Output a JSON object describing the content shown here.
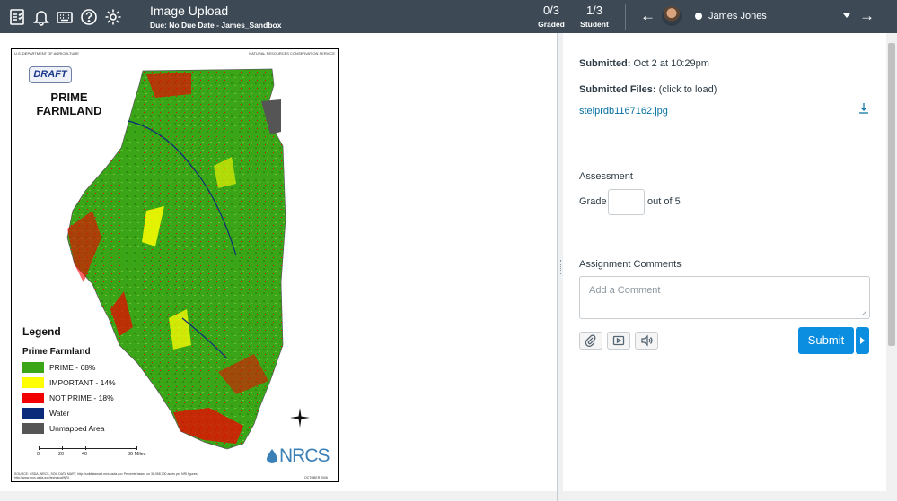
{
  "header": {
    "icons": [
      "assignment-list-icon",
      "bell-icon",
      "keyboard-icon",
      "help-icon",
      "gear-icon"
    ],
    "title": "Image Upload",
    "due": "Due: No Due Date - James_Sandbox",
    "graded_num": "0/3",
    "graded_label": "Graded",
    "student_num": "1/3",
    "student_label": "Student",
    "prev_arrow": "←",
    "next_arrow": "→",
    "student_name": "James Jones"
  },
  "map": {
    "header_left": "U.S. DEPARTMENT OF AGRICULTURE",
    "header_right": "NATURAL RESOURCES CONSERVATION SERVICE",
    "draft": "DRAFT",
    "title": "PRIME FARMLAND",
    "legend_title": "Legend",
    "legend_subtitle": "Prime Farmland",
    "legend": [
      {
        "label": "PRIME - 68%",
        "color": "#3aa617"
      },
      {
        "label": "IMPORTANT - 14%",
        "color": "#ffff00"
      },
      {
        "label": "NOT PRIME - 18%",
        "color": "#f20000"
      },
      {
        "label": "Water",
        "color": "#0a2b7a"
      },
      {
        "label": "Unmapped Area",
        "color": "#555555"
      }
    ],
    "scale_ticks": [
      "0",
      "20",
      "40",
      "80 Miles"
    ],
    "logo": "NRCS",
    "source": "SOURCE: USDA, NRCS, SOIL DATA MART, http://soildatamart.nrcs.usda.gov Percents based on 36,058,700 acres per NRI figures, http://www.nrcs.usda.gov/technical/NRI",
    "date": "OCTOBER 2006"
  },
  "submission": {
    "submitted_label": "Submitted:",
    "submitted_value": "Oct 2 at 10:29pm",
    "files_label": "Submitted Files:",
    "files_hint": "(click to load)",
    "file_name": "stelprdb1167162.jpg"
  },
  "assessment": {
    "heading": "Assessment",
    "grade_label": "Grade",
    "grade_value": "",
    "out_of": "out of 5"
  },
  "comments": {
    "heading": "Assignment Comments",
    "placeholder": "Add a Comment",
    "submit_label": "Submit"
  }
}
